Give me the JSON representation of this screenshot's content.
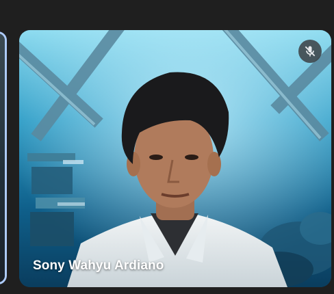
{
  "participants": [
    {
      "name": "Sony Wahyu Ardiano",
      "mic_muted": true,
      "mic_icon": "mic-off-icon"
    }
  ],
  "colors": {
    "background": "#1f1f1f",
    "active_border": "#aecbfa",
    "badge_bg": "#3c4043"
  }
}
